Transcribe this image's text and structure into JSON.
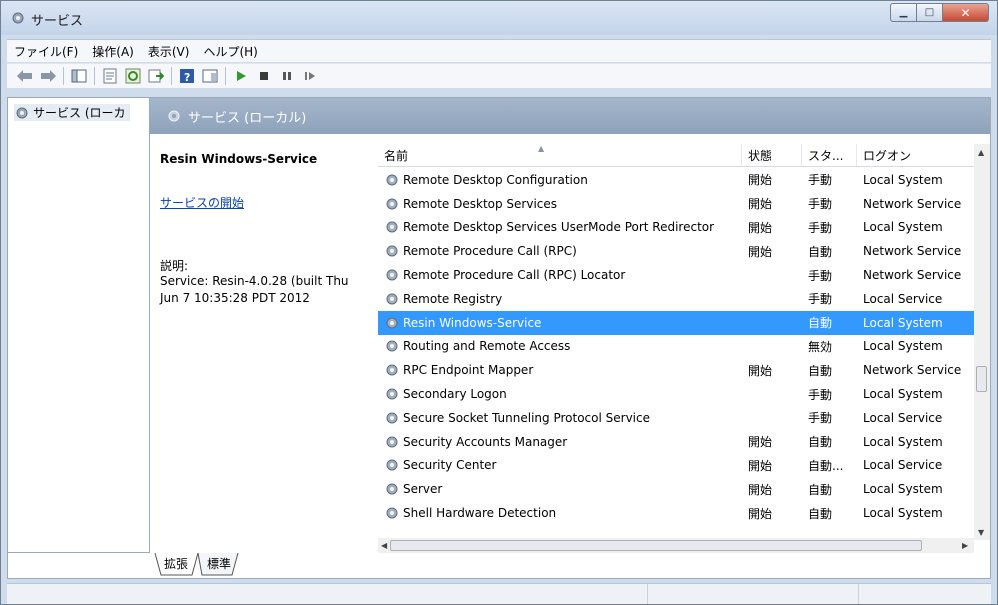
{
  "window": {
    "title": "サービス"
  },
  "menu": [
    "ファイル(F)",
    "操作(A)",
    "表示(V)",
    "ヘルプ(H)"
  ],
  "tree": {
    "node_label": "サービス (ローカ"
  },
  "panel": {
    "header": "サービス (ローカル)"
  },
  "description": {
    "service_name": "Resin Windows-Service",
    "start_link": "サービスの開始",
    "label": "説明:",
    "text": "Service: Resin-4.0.28 (built Thu Jun  7 10:35:28 PDT 2012"
  },
  "columns": {
    "name": "名前",
    "state": "状態",
    "startup": "スタ...",
    "logon": "ログオン"
  },
  "services": [
    {
      "name": "Remote Desktop Configuration",
      "state": "開始",
      "startup": "手動",
      "logon": "Local System"
    },
    {
      "name": "Remote Desktop Services",
      "state": "開始",
      "startup": "手動",
      "logon": "Network Service"
    },
    {
      "name": "Remote Desktop Services UserMode Port Redirector",
      "state": "開始",
      "startup": "手動",
      "logon": "Local System"
    },
    {
      "name": "Remote Procedure Call (RPC)",
      "state": "開始",
      "startup": "自動",
      "logon": "Network Service"
    },
    {
      "name": "Remote Procedure Call (RPC) Locator",
      "state": "",
      "startup": "手動",
      "logon": "Network Service"
    },
    {
      "name": "Remote Registry",
      "state": "",
      "startup": "手動",
      "logon": "Local Service"
    },
    {
      "name": "Resin Windows-Service",
      "state": "",
      "startup": "自動",
      "logon": "Local System"
    },
    {
      "name": "Routing and Remote Access",
      "state": "",
      "startup": "無効",
      "logon": "Local System"
    },
    {
      "name": "RPC Endpoint Mapper",
      "state": "開始",
      "startup": "自動",
      "logon": "Network Service"
    },
    {
      "name": "Secondary Logon",
      "state": "",
      "startup": "手動",
      "logon": "Local System"
    },
    {
      "name": "Secure Socket Tunneling Protocol Service",
      "state": "",
      "startup": "手動",
      "logon": "Local Service"
    },
    {
      "name": "Security Accounts Manager",
      "state": "開始",
      "startup": "自動",
      "logon": "Local System"
    },
    {
      "name": "Security Center",
      "state": "開始",
      "startup": "自動...",
      "logon": "Local Service"
    },
    {
      "name": "Server",
      "state": "開始",
      "startup": "自動",
      "logon": "Local System"
    },
    {
      "name": "Shell Hardware Detection",
      "state": "開始",
      "startup": "自動",
      "logon": "Local System"
    }
  ],
  "selected_service": "Resin Windows-Service",
  "tabs": [
    "拡張",
    "標準"
  ],
  "colors": {
    "selection": "#3399ff",
    "header": "#8ea2bb",
    "link": "#0645ad"
  }
}
